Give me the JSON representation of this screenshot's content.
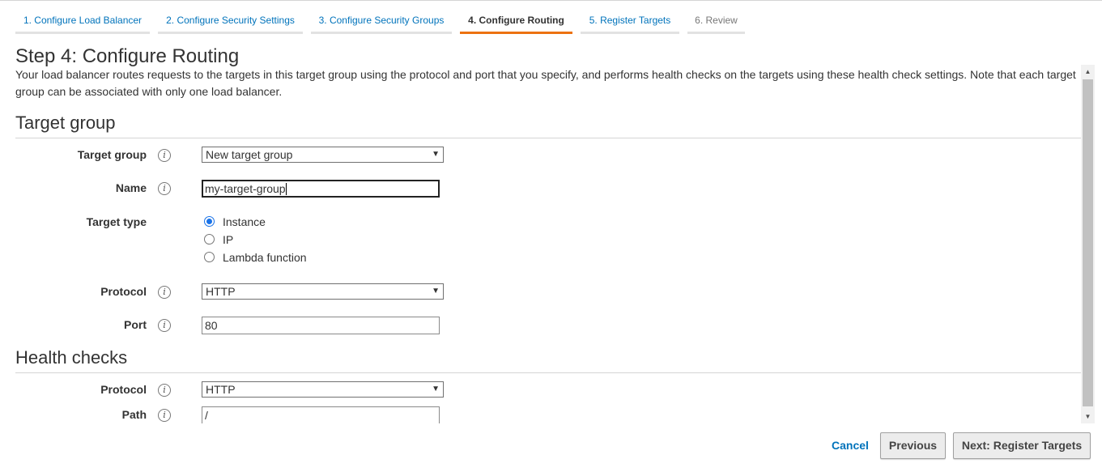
{
  "wizard_tabs": [
    {
      "label": "1. Configure Load Balancer",
      "state": "link"
    },
    {
      "label": "2. Configure Security Settings",
      "state": "link"
    },
    {
      "label": "3. Configure Security Groups",
      "state": "link"
    },
    {
      "label": "4. Configure Routing",
      "state": "active"
    },
    {
      "label": "5. Register Targets",
      "state": "link"
    },
    {
      "label": "6. Review",
      "state": "disabled"
    }
  ],
  "page": {
    "title": "Step 4: Configure Routing",
    "description": "Your load balancer routes requests to the targets in this target group using the protocol and port that you specify, and performs health checks on the targets using these health check settings. Note that each target group can be associated with only one load balancer."
  },
  "target_group_section": {
    "heading": "Target group",
    "target_group": {
      "label": "Target group",
      "value": "New target group"
    },
    "name": {
      "label": "Name",
      "value": "my-target-group"
    },
    "target_type": {
      "label": "Target type",
      "options": [
        "Instance",
        "IP",
        "Lambda function"
      ],
      "selected": "Instance"
    },
    "protocol": {
      "label": "Protocol",
      "value": "HTTP"
    },
    "port": {
      "label": "Port",
      "value": "80"
    }
  },
  "health_checks_section": {
    "heading": "Health checks",
    "protocol": {
      "label": "Protocol",
      "value": "HTTP"
    },
    "path": {
      "label": "Path",
      "value": "/"
    }
  },
  "footer": {
    "cancel": "Cancel",
    "previous": "Previous",
    "next": "Next: Register Targets"
  },
  "icons": {
    "info": "info-icon",
    "dropdown": "chevron-down-icon",
    "scroll_up": "arrow-up-icon",
    "scroll_down": "arrow-down-icon"
  },
  "colors": {
    "link": "#0073bb",
    "active_tab_underline": "#ec7211",
    "radio_selected": "#1a73e8"
  }
}
